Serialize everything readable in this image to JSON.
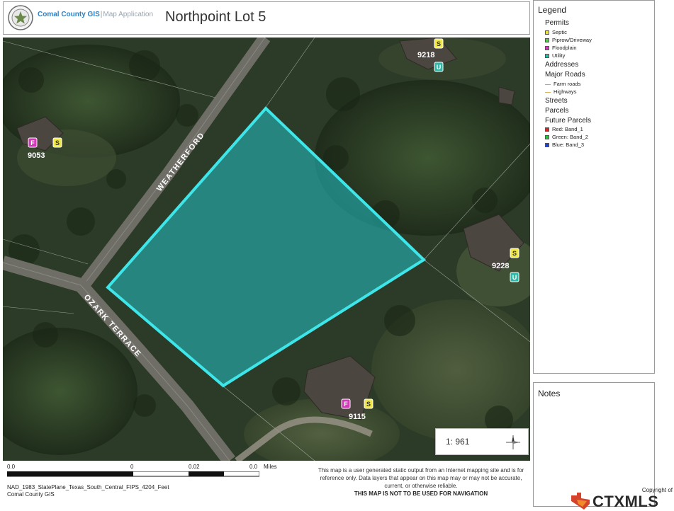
{
  "header": {
    "org_name": "Comal County GIS",
    "separator": "|",
    "app_name": "Map Application",
    "map_title": "Northpoint Lot 5"
  },
  "map": {
    "parcel_fill_color": "#22c4c9",
    "parcel_outline_color": "#3ee6ea",
    "road_labels": {
      "weatherford": "WEATHERFORD",
      "ozark": "OZARK TERRACE"
    },
    "addresses": [
      "9053",
      "9218",
      "9228",
      "9115"
    ],
    "permit_markers": {
      "septic": "S",
      "utility": "U",
      "floodplain": "F"
    },
    "scale_ratio": "1: 961",
    "compass": "compass-icon"
  },
  "footer": {
    "scale_ticks": [
      "0.0",
      "0",
      "0.02",
      "0.0"
    ],
    "scale_units": "Miles",
    "projection": "NAD_1983_StatePlane_Texas_South_Central_FIPS_4204_Feet",
    "org": "Comal County GIS",
    "disclaimer": "This map is a user generated static output from an Internet mapping site and is for reference only. Data layers that appear on this map may or may not be accurate, current, or otherwise reliable.",
    "warning": "THIS MAP IS NOT TO BE USED FOR NAVIGATION"
  },
  "legend": {
    "title": "Legend",
    "permits_label": "Permits",
    "permits": [
      {
        "label": "Septic",
        "color": "#e8e23a"
      },
      {
        "label": "Piprow/Driveway",
        "color": "#55c94b"
      },
      {
        "label": "Floodplain",
        "color": "#d13ab8"
      },
      {
        "label": "Utility",
        "color": "#2fb8a8"
      }
    ],
    "addresses_label": "Addresses",
    "major_roads_label": "Major Roads",
    "roads": [
      {
        "label": "Farm roads",
        "color": "#b0a8a0"
      },
      {
        "label": "Highways",
        "color": "#d9b35c"
      }
    ],
    "streets_label": "Streets",
    "parcels_label": "Parcels",
    "future_parcels_label": "Future Parcels",
    "future_parcels": [
      {
        "prefix": "Red:",
        "label": "Band_1",
        "color": "#e02020"
      },
      {
        "prefix": "Green:",
        "label": "Band_2",
        "color": "#22c43a"
      },
      {
        "prefix": "Blue:",
        "label": "Band_3",
        "color": "#2040d8"
      }
    ]
  },
  "notes": {
    "title": "Notes"
  },
  "watermark": {
    "copyright": "Copyright of",
    "brand": "CTXMLS"
  }
}
